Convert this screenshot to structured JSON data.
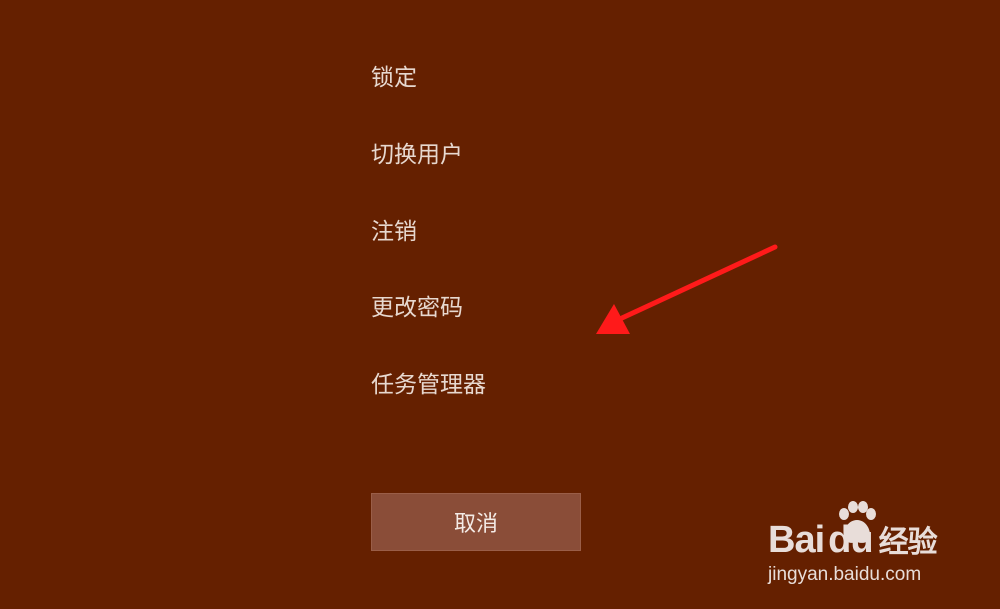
{
  "menu": {
    "items": [
      {
        "label": "锁定"
      },
      {
        "label": "切换用户"
      },
      {
        "label": "注销"
      },
      {
        "label": "更改密码"
      },
      {
        "label": "任务管理器"
      }
    ]
  },
  "cancel": {
    "label": "取消"
  },
  "watermark": {
    "brand_bai": "Bai",
    "brand_du": "du",
    "brand_jingyan": "经验",
    "url": "jingyan.baidu.com"
  },
  "colors": {
    "background": "#652000",
    "menu_text": "#e7d8cf",
    "button": "#8a4d38",
    "arrow": "#ff1a1a"
  }
}
